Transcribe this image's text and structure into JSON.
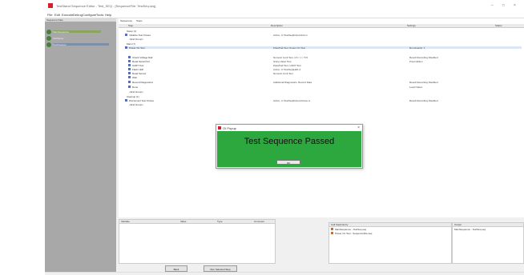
{
  "window": {
    "title": "TestStand Sequence Editor - Test_SEQ - [SequenceFile: TestSeq.seq]"
  },
  "menu": [
    "File",
    "Edit",
    "Execute",
    "Debug",
    "Configure",
    "Tools",
    "Help"
  ],
  "sequences_panel": {
    "header": "Sequence Files",
    "items": [
      "MainSequence",
      "TestSetup",
      "TestCleanup"
    ]
  },
  "main": {
    "tabs": [
      "Sequences",
      "Steps"
    ],
    "columns": [
      "Step",
      "Description",
      "Settings",
      "Status"
    ],
    "rows": [
      {
        "name": "Setup (1)",
        "desc": "",
        "settings": ""
      },
      {
        "name": "Initialize Test Fixture",
        "desc": "Action, C:\\TestSeq\\Fixture\\Init.vi",
        "settings": ""
      },
      {
        "name": "<End Group>",
        "desc": "",
        "settings": ""
      },
      {
        "name": "Main (7)",
        "desc": "",
        "settings": ""
      },
      {
        "name": "Power On Test",
        "desc": "Pass/Fail Test, Power On Test",
        "settings": "Run Exactly: 1"
      },
      {
        "name": "Check Voltage Rail",
        "desc": "Numeric Limit Test, 4.5 < x < 5.5",
        "settings": "Result Recording Disabled"
      },
      {
        "name": "Read Serial Port",
        "desc": "String Value Test",
        "settings": "Precondition"
      },
      {
        "name": "UART Test",
        "desc": "Pass/Fail Test, UART Test",
        "settings": ""
      },
      {
        "name": "Flash LED",
        "desc": "Action, C:\\TestSeq\\LED.vi",
        "settings": ""
      },
      {
        "name": "Read Sensor",
        "desc": "Numeric Limit Test",
        "settings": ""
      },
      {
        "name": "Wait",
        "desc": "",
        "settings": ""
      },
      {
        "name": "Record Diagnostics",
        "desc": "Additional Diagnostics, Record Data",
        "settings": "Result Recording Disabled"
      },
      {
        "name": "Done",
        "desc": "",
        "settings": "Load Option"
      },
      {
        "name": "<End Group>",
        "desc": "",
        "settings": ""
      },
      {
        "name": "Cleanup (1)",
        "desc": "",
        "settings": ""
      },
      {
        "name": "Disconnect Test Fixture",
        "desc": "Action, C:\\TestSeq\\Fixture\\Close.vi",
        "settings": "Result Recording Disabled"
      },
      {
        "name": "<End Group>",
        "desc": "",
        "settings": ""
      }
    ]
  },
  "dialog": {
    "title": "OI Popup",
    "message": "Test Sequence Passed",
    "ok_label": "OK"
  },
  "variables_panel": {
    "columns": [
      "Variable",
      "Value",
      "Type",
      "Comment"
    ]
  },
  "call_stack_panel": {
    "header": "Call Stack Entry",
    "rows": [
      "MainSequence - TestSeq.seq",
      "Power On Test - SequenceFile.seq"
    ]
  },
  "output_panel": {
    "header": "Output",
    "rows": [
      "MainSequence - TestSeq.seq"
    ]
  },
  "buttons": {
    "back": "Back",
    "run_selected": "Run Selected Step"
  },
  "colors": {
    "accent": "#d3202a",
    "pass_green": "#2ca83e",
    "status_green": "#1f9e3a",
    "status_blue": "#38a6d8"
  }
}
